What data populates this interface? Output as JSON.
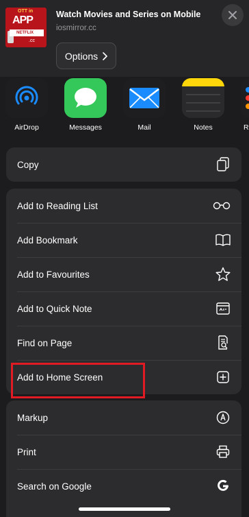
{
  "header": {
    "title": "Watch Movies and Series on Mobile",
    "url": "iosmirror.cc",
    "options_label": "Options",
    "thumbnail": {
      "line1": "OTT in",
      "line2": "APP",
      "line3": "NETFLIX",
      "line4": ".cc"
    }
  },
  "apps": [
    {
      "label": "AirDrop",
      "icon": "airdrop-icon"
    },
    {
      "label": "Messages",
      "icon": "messages-icon"
    },
    {
      "label": "Mail",
      "icon": "mail-icon"
    },
    {
      "label": "Notes",
      "icon": "notes-icon"
    },
    {
      "label": "R",
      "icon": "reminders-icon"
    }
  ],
  "group1": [
    {
      "label": "Copy",
      "icon": "copy-icon"
    }
  ],
  "group2": [
    {
      "label": "Add to Reading List",
      "icon": "glasses-icon"
    },
    {
      "label": "Add Bookmark",
      "icon": "book-icon"
    },
    {
      "label": "Add to Favourites",
      "icon": "star-icon"
    },
    {
      "label": "Add to Quick Note",
      "icon": "quick-note-icon"
    },
    {
      "label": "Find on Page",
      "icon": "find-on-page-icon"
    },
    {
      "label": "Add to Home Screen",
      "icon": "add-square-icon"
    }
  ],
  "group3": [
    {
      "label": "Markup",
      "icon": "markup-icon"
    },
    {
      "label": "Print",
      "icon": "printer-icon"
    },
    {
      "label": "Search on Google",
      "icon": "google-icon"
    }
  ],
  "colors": {
    "background": "#1c1c1e",
    "group": "#2c2c2e",
    "highlight": "#e01b24"
  }
}
